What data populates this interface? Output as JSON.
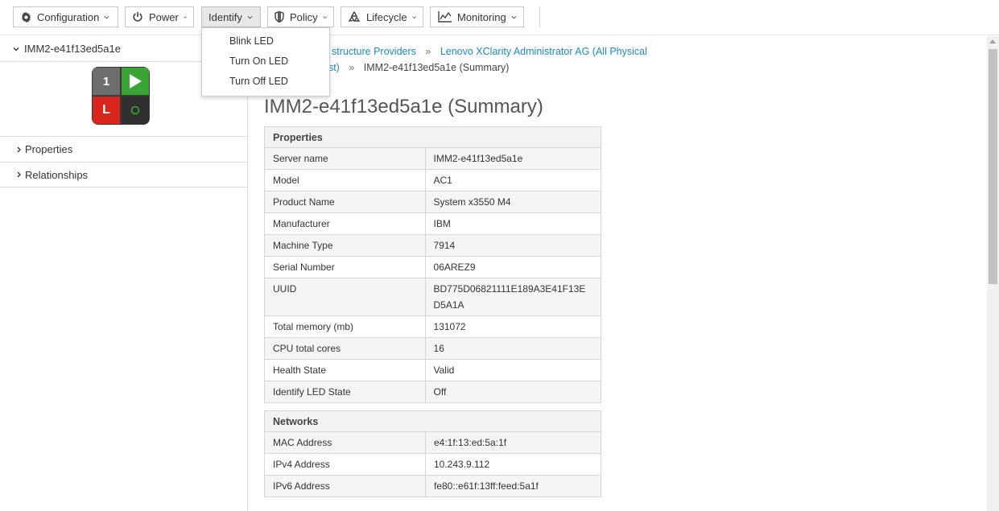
{
  "toolbar": {
    "buttons": [
      {
        "label": "Configuration",
        "icon": "gear-icon"
      },
      {
        "label": "Power",
        "icon": "power-icon"
      },
      {
        "label": "Identify",
        "icon": ""
      },
      {
        "label": "Policy",
        "icon": "shield-icon"
      },
      {
        "label": "Lifecycle",
        "icon": "recycle-icon"
      },
      {
        "label": "Monitoring",
        "icon": "chart-line-icon"
      }
    ]
  },
  "identify_menu": {
    "items": [
      "Blink LED",
      "Turn On LED",
      "Turn Off LED"
    ]
  },
  "sidebar": {
    "title": "IMM2-e41f13ed5a1e",
    "logo": {
      "top_left": "1",
      "bottom_left": "L"
    },
    "sections": [
      "Properties",
      "Relationships"
    ]
  },
  "breadcrumb": {
    "item1": "structure Providers",
    "sep": "»",
    "item2": "Lenovo XClarity Administrator AG (All Physical",
    "item2b": "ost)",
    "current": "IMM2-e41f13ed5a1e (Summary)"
  },
  "page": {
    "title": "IMM2-e41f13ed5a1e (Summary)"
  },
  "properties": {
    "header": "Properties",
    "rows": [
      {
        "key": "Server name",
        "value": "IMM2-e41f13ed5a1e"
      },
      {
        "key": "Model",
        "value": "AC1"
      },
      {
        "key": "Product Name",
        "value": "System x3550 M4"
      },
      {
        "key": "Manufacturer",
        "value": "IBM"
      },
      {
        "key": "Machine Type",
        "value": "7914"
      },
      {
        "key": "Serial Number",
        "value": "06AREZ9"
      },
      {
        "key": "UUID",
        "value": "BD775D06821111E189A3E41F13ED5A1A"
      },
      {
        "key": "Total memory (mb)",
        "value": "131072"
      },
      {
        "key": "CPU total cores",
        "value": "16"
      },
      {
        "key": "Health State",
        "value": "Valid"
      },
      {
        "key": "Identify LED State",
        "value": "Off"
      }
    ]
  },
  "networks": {
    "header": "Networks",
    "rows": [
      {
        "key": "MAC Address",
        "value": "e4:1f:13:ed:5a:1f"
      },
      {
        "key": "IPv4 Address",
        "value": "10.243.9.112"
      },
      {
        "key": "IPv6 Address",
        "value": "fe80::e61f:13ff:feed:5a1f"
      }
    ]
  },
  "colors": {
    "link": "#1a8ac6",
    "logo_green": "#3aa535",
    "logo_red": "#d9261c",
    "logo_gray": "#6d6d6d"
  }
}
